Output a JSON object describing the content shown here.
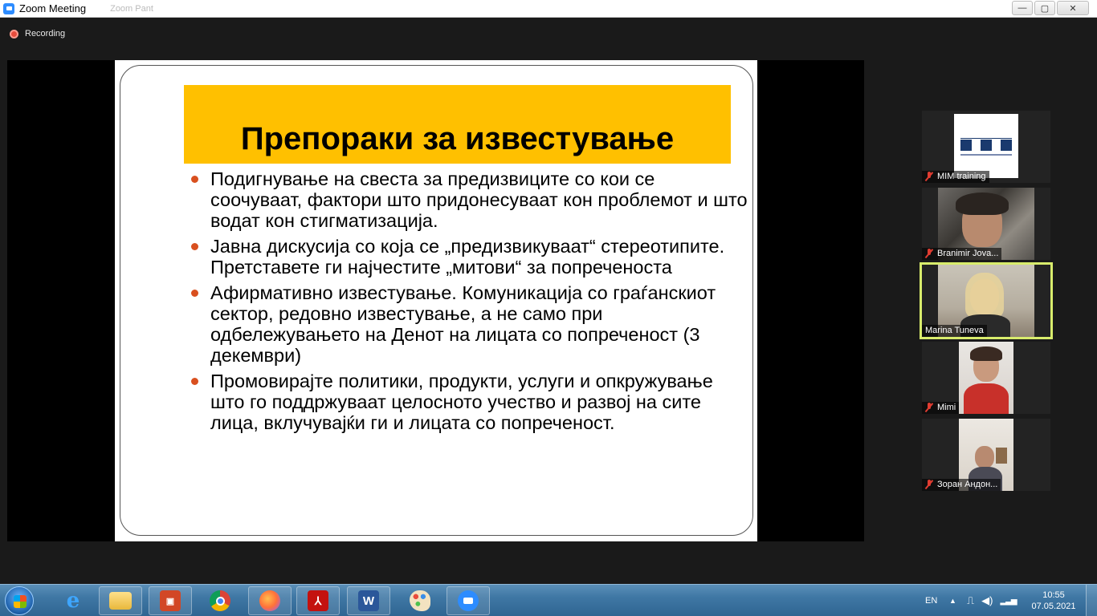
{
  "window": {
    "title": "Zoom Meeting",
    "ghost_text": "Zoom  Pant"
  },
  "window_controls": {
    "minimize": "—",
    "maximize": "▢",
    "close": "✕"
  },
  "recording": {
    "label": "Recording"
  },
  "slide": {
    "title": "Препораки за известување",
    "bullets": [
      "Подигнување на свеста за предизвиците со кои се соочуваат, фактори што придонесуваат кон проблемот и што водат кон стигматизација.",
      "Јавна дискусија со која се „предизвикуваат“ стереотипите. Претставете ги најчестите „митови“ за попреченоста",
      "Афирмативно известување. Комуникација со граѓанскиот сектор, редовно известување, а не само при одбележувањето на Денот на лицата со попреченост (3 декември)",
      "Промовирајте политики, продукти, услуги и опкружување што го поддржуваат целосното учество и развој на сите лица, вклучувајќи ги и лицата со попреченост."
    ]
  },
  "participants": [
    {
      "name": "MIM training",
      "muted": true,
      "active": false
    },
    {
      "name": "Branimir Jova...",
      "muted": true,
      "active": false
    },
    {
      "name": "Marina Tuneva",
      "muted": false,
      "active": true
    },
    {
      "name": "Mimi",
      "muted": true,
      "active": false
    },
    {
      "name": "Зоран Андон...",
      "muted": true,
      "active": false
    }
  ],
  "taskbar": {
    "language": "EN",
    "time": "10:55",
    "date": "07.05.2021",
    "apps": [
      "internet-explorer-icon",
      "file-explorer-icon",
      "presentation-icon",
      "chrome-icon",
      "firefox-icon",
      "acrobat-icon",
      "word-icon",
      "paint-icon",
      "zoom-icon"
    ]
  },
  "colors": {
    "slide_title_bg": "#ffc000",
    "bullet": "#d9501f",
    "active_speaker_border": "#d8ec6c",
    "recording_dot": "#e74c3c",
    "zoom_blue": "#2d8cff"
  }
}
